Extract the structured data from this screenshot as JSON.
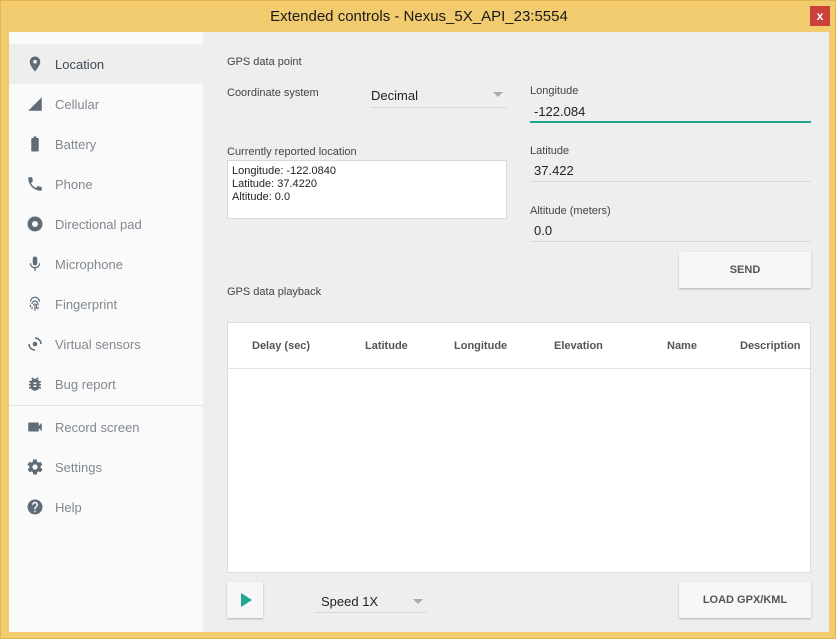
{
  "window": {
    "title": "Extended controls - Nexus_5X_API_23:5554",
    "close_label": "x"
  },
  "sidebar": {
    "items": [
      {
        "label": "Location",
        "icon": "location-pin-icon"
      },
      {
        "label": "Cellular",
        "icon": "cellular-signal-icon"
      },
      {
        "label": "Battery",
        "icon": "battery-icon"
      },
      {
        "label": "Phone",
        "icon": "phone-icon"
      },
      {
        "label": "Directional pad",
        "icon": "dpad-icon"
      },
      {
        "label": "Microphone",
        "icon": "microphone-icon"
      },
      {
        "label": "Fingerprint",
        "icon": "fingerprint-icon"
      },
      {
        "label": "Virtual sensors",
        "icon": "rotation-sensor-icon"
      },
      {
        "label": "Bug report",
        "icon": "bug-icon"
      },
      {
        "label": "Record screen",
        "icon": "video-camera-icon"
      },
      {
        "label": "Settings",
        "icon": "gear-icon"
      },
      {
        "label": "Help",
        "icon": "help-icon"
      }
    ]
  },
  "gps_point": {
    "section_title": "GPS data point",
    "coord_system_label": "Coordinate system",
    "coord_system_value": "Decimal",
    "current_location_label": "Currently reported location",
    "current_location_lines": [
      "Longitude: -122.0840",
      "Latitude: 37.4220",
      "Altitude: 0.0"
    ],
    "longitude_label": "Longitude",
    "longitude_value": "-122.084",
    "latitude_label": "Latitude",
    "latitude_value": "37.422",
    "altitude_label": "Altitude (meters)",
    "altitude_value": "0.0",
    "send_label": "SEND"
  },
  "playback": {
    "section_title": "GPS data playback",
    "columns": [
      "Delay (sec)",
      "Latitude",
      "Longitude",
      "Elevation",
      "Name",
      "Description"
    ],
    "speed_value": "Speed 1X",
    "load_label": "LOAD GPX/KML"
  },
  "colors": {
    "accent": "#20a592",
    "window_frame": "#f2cb6e",
    "close": "#c9413a"
  }
}
